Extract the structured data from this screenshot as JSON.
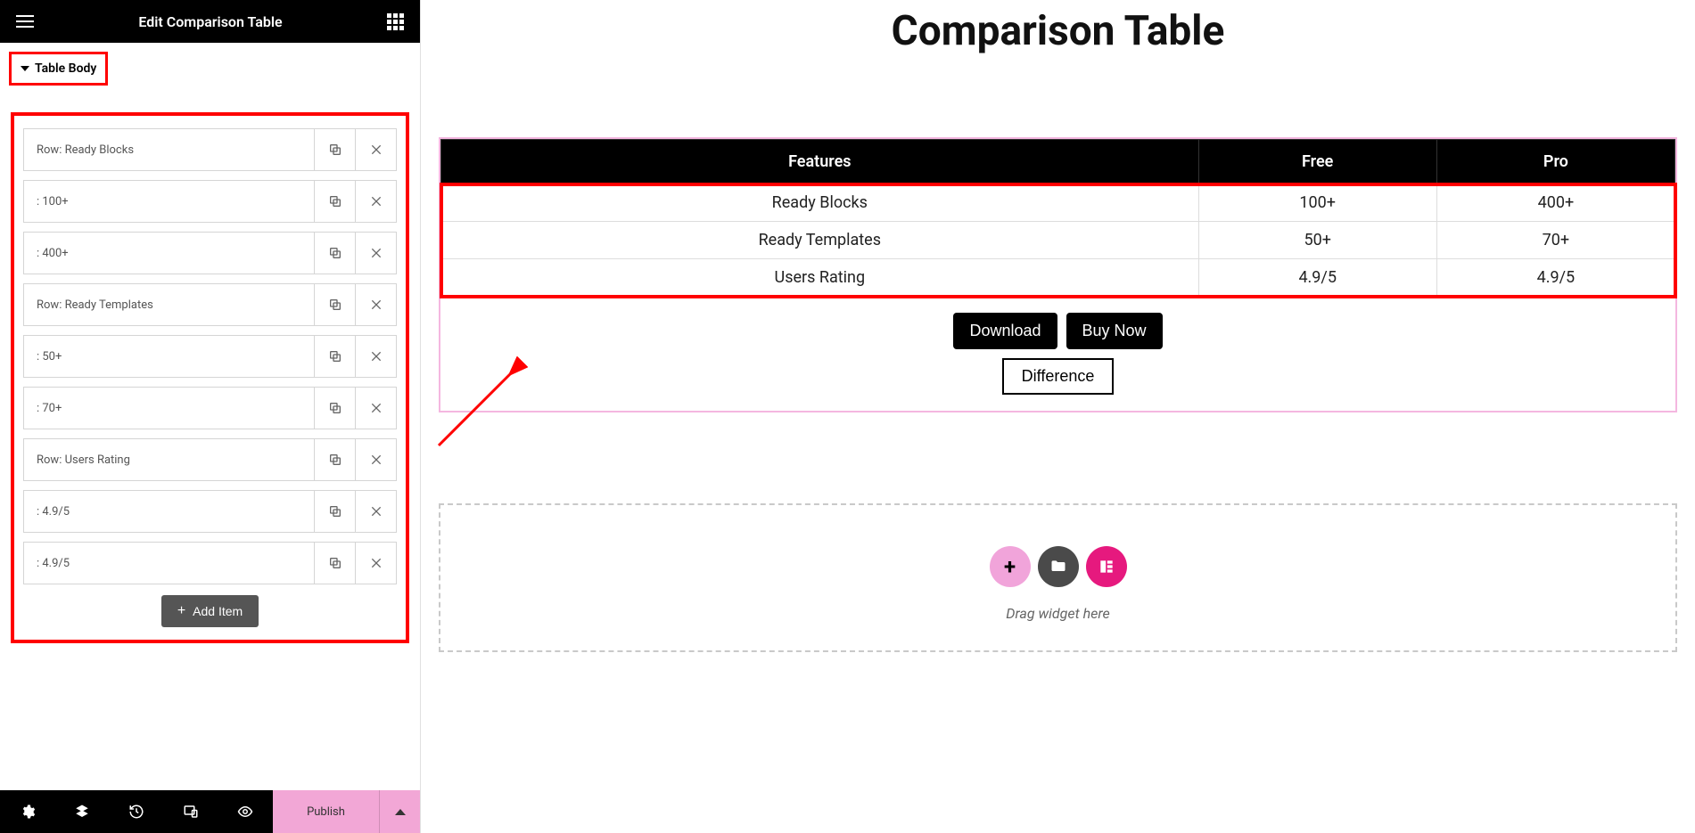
{
  "sidebar": {
    "title": "Edit Comparison Table",
    "section_label": "Table Body",
    "items": [
      {
        "label": "Row: Ready Blocks"
      },
      {
        "label": ": 100+"
      },
      {
        "label": ": 400+"
      },
      {
        "label": "Row: Ready Templates"
      },
      {
        "label": ": 50+"
      },
      {
        "label": ": 70+"
      },
      {
        "label": "Row: Users Rating"
      },
      {
        "label": ": 4.9/5"
      },
      {
        "label": ": 4.9/5"
      }
    ],
    "add_item_label": "Add Item",
    "publish_label": "Publish"
  },
  "page": {
    "title": "Comparison Table",
    "headers": [
      "Features",
      "Free",
      "Pro"
    ],
    "rows": [
      [
        "Ready Blocks",
        "100+",
        "400+"
      ],
      [
        "Ready Templates",
        "50+",
        "70+"
      ],
      [
        "Users Rating",
        "4.9/5",
        "4.9/5"
      ]
    ],
    "download_label": "Download",
    "buy_label": "Buy Now",
    "difference_label": "Difference",
    "dropzone_text": "Drag widget here"
  }
}
